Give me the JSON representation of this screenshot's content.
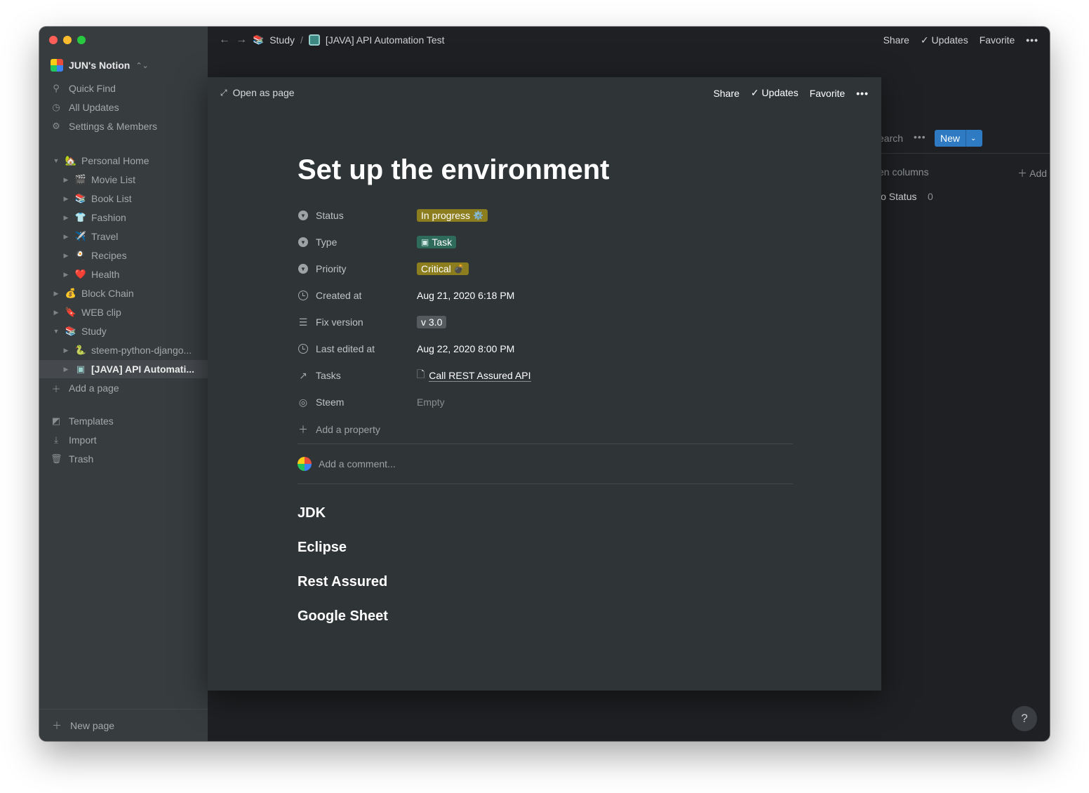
{
  "sidebar": {
    "workspace_name": "JUN's Notion",
    "nav": [
      {
        "label": "Quick Find",
        "icon": "search-icon"
      },
      {
        "label": "All Updates",
        "icon": "clock-icon"
      },
      {
        "label": "Settings & Members",
        "icon": "gear-icon"
      }
    ],
    "tree": [
      {
        "label": "Personal Home",
        "emoji": "🏡"
      },
      {
        "label": "Movie List",
        "emoji": "🎬"
      },
      {
        "label": "Book List",
        "emoji": "📚"
      },
      {
        "label": "Fashion",
        "emoji": "👕"
      },
      {
        "label": "Travel",
        "emoji": "✈️"
      },
      {
        "label": "Recipes",
        "emoji": "🍳"
      },
      {
        "label": "Health",
        "emoji": "❤️"
      },
      {
        "label": "Block Chain",
        "emoji": "💰"
      },
      {
        "label": "WEB clip",
        "emoji": "🔖"
      },
      {
        "label": "Study",
        "emoji": "📚"
      },
      {
        "label": "steem-python-django...",
        "emoji": "🐍"
      },
      {
        "label": "[JAVA] API Automati...",
        "emoji": "▣"
      }
    ],
    "add_page": "Add a page",
    "bottom": [
      {
        "label": "Templates",
        "icon": "templates-icon"
      },
      {
        "label": "Import",
        "icon": "import-icon"
      },
      {
        "label": "Trash",
        "icon": "trash-icon"
      }
    ],
    "new_page": "New page"
  },
  "topbar": {
    "crumb_1": "Study",
    "separator": "/",
    "crumb_2": "[JAVA] API Automation Test",
    "share": "Share",
    "updates": "Updates",
    "favorite": "Favorite"
  },
  "background_db": {
    "search": "earch",
    "new": "New",
    "columns": "en columns",
    "add": "Add",
    "no_status": "lo Status",
    "no_status_count": "0"
  },
  "modal": {
    "open_as_page": "Open as page",
    "share": "Share",
    "updates": "Updates",
    "favorite": "Favorite",
    "title": "Set up the environment",
    "properties": {
      "status": {
        "name": "Status",
        "value": "In progress",
        "emoji": "⚙️"
      },
      "type": {
        "name": "Type",
        "value": "Task",
        "emoji": "▣"
      },
      "priority": {
        "name": "Priority",
        "value": "Critical",
        "emoji": "💣"
      },
      "created": {
        "name": "Created at",
        "value": "Aug 21, 2020 6:18 PM"
      },
      "fix": {
        "name": "Fix version",
        "value": "v 3.0"
      },
      "edited": {
        "name": "Last edited at",
        "value": "Aug 22, 2020 8:00 PM"
      },
      "tasks": {
        "name": "Tasks",
        "value": "Call REST Assured API"
      },
      "steem": {
        "name": "Steem",
        "value": "Empty"
      }
    },
    "add_property": "Add a property",
    "add_comment": "Add a comment...",
    "headings": [
      "JDK",
      "Eclipse",
      "Rest Assured",
      "Google Sheet"
    ]
  },
  "help": "?",
  "colors": {
    "accent": "#2e7bc4",
    "sidebar_bg": "#373c3f",
    "modal_bg": "#2f3437",
    "tag_yellow": "#8c7d1f",
    "tag_green": "#2f6b5a"
  }
}
